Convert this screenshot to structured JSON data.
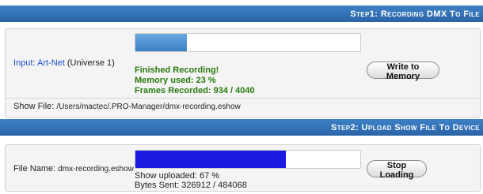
{
  "colors": {
    "header_bg": "#3573b9",
    "progress1_fill": "#4a90d0",
    "progress2_fill": "#1a1ae0",
    "status_green": "#2a7a10",
    "link_blue": "#1f4fd0"
  },
  "step1": {
    "header": "Step1: Recording DMX To File",
    "input_label": "Input:",
    "input_value": "Art-Net",
    "input_universe": "(Universe 1)",
    "progress": 0.23,
    "status_title": "Finished Recording!",
    "memory_used": "Memory used: 23 %",
    "frames_recorded": "Frames Recorded: 934 / 4040",
    "write_button": "Write to Memory",
    "show_file_label": "Show File:",
    "show_file_path": "/Users/mactec/.PRO-Manager/dmx-recording.eshow"
  },
  "step2": {
    "header": "Step2: Upload Show File To Device",
    "file_name_label": "File Name:",
    "file_name_value": "dmx-recording.eshow",
    "progress": 0.67,
    "show_uploaded": "Show uploaded: 67 %",
    "bytes_sent": "Bytes Sent: 326912 / 484068",
    "stop_button": "Stop Loading"
  }
}
